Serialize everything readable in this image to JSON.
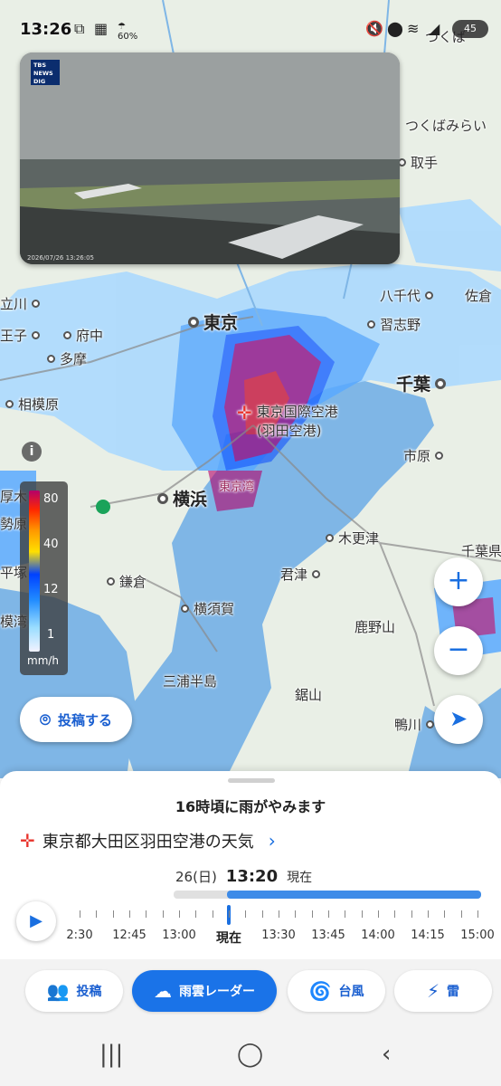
{
  "status_bar": {
    "time": "13:26",
    "battery": "45",
    "weather_percent": "60%"
  },
  "live_camera": {
    "logo": "TBS NEWS DIG",
    "timestamp": "2026/07/26  13:26:05"
  },
  "map": {
    "places": {
      "tsukuba": "つくば",
      "tsukubamirai": "つくばみらい",
      "toride": "取手",
      "tachikawa": "立川",
      "hachioji": "王子",
      "fuchu": "府中",
      "tama": "多摩",
      "sagamihara": "相模原",
      "atsugi": "厚木",
      "isehara": "勢原",
      "hiratsuka": "平塚",
      "shonan": "模湾",
      "tokyo": "東京",
      "yokohama": "横浜",
      "chiba": "千葉",
      "yachiyo": "八千代",
      "narashino": "習志野",
      "sakura": "佐倉",
      "ichihara": "市原",
      "kisarazu": "木更津",
      "kimitsu": "君津",
      "kamakura": "鎌倉",
      "yokosuka": "横須賀",
      "miura": "三浦半島",
      "kanozan": "鹿野山",
      "nokogiriyama": "鋸山",
      "kamogawa": "鴨川",
      "chiba_pref": "千葉県",
      "tokyo_bay_label": "東京湾",
      "haneda": "東京国際空港\n(羽田空港)"
    }
  },
  "legend": {
    "labels": [
      "80",
      "40",
      "12",
      "1"
    ],
    "unit": "mm/h"
  },
  "buttons": {
    "post": "投稿する",
    "zoom_in": "+",
    "zoom_out": "−"
  },
  "sheet": {
    "forecast": "16時頃に雨がやみます",
    "location": "東京都大田区羽田空港の天気",
    "date": "26(日)",
    "time": "13:20",
    "now": "現在",
    "timeline": {
      "labels": [
        "2:30",
        "12:45",
        "13:00",
        "現在",
        "13:30",
        "13:45",
        "14:00",
        "14:15",
        "15:00"
      ],
      "now_fraction": 0.26
    }
  },
  "tabs": [
    {
      "label": "投稿"
    },
    {
      "label": "雨雲レーダー"
    },
    {
      "label": "台風"
    },
    {
      "label": "雷"
    }
  ],
  "colors": {
    "accent": "#1a73e8",
    "sea": "#7fb6e6",
    "land": "#e9efe6"
  }
}
